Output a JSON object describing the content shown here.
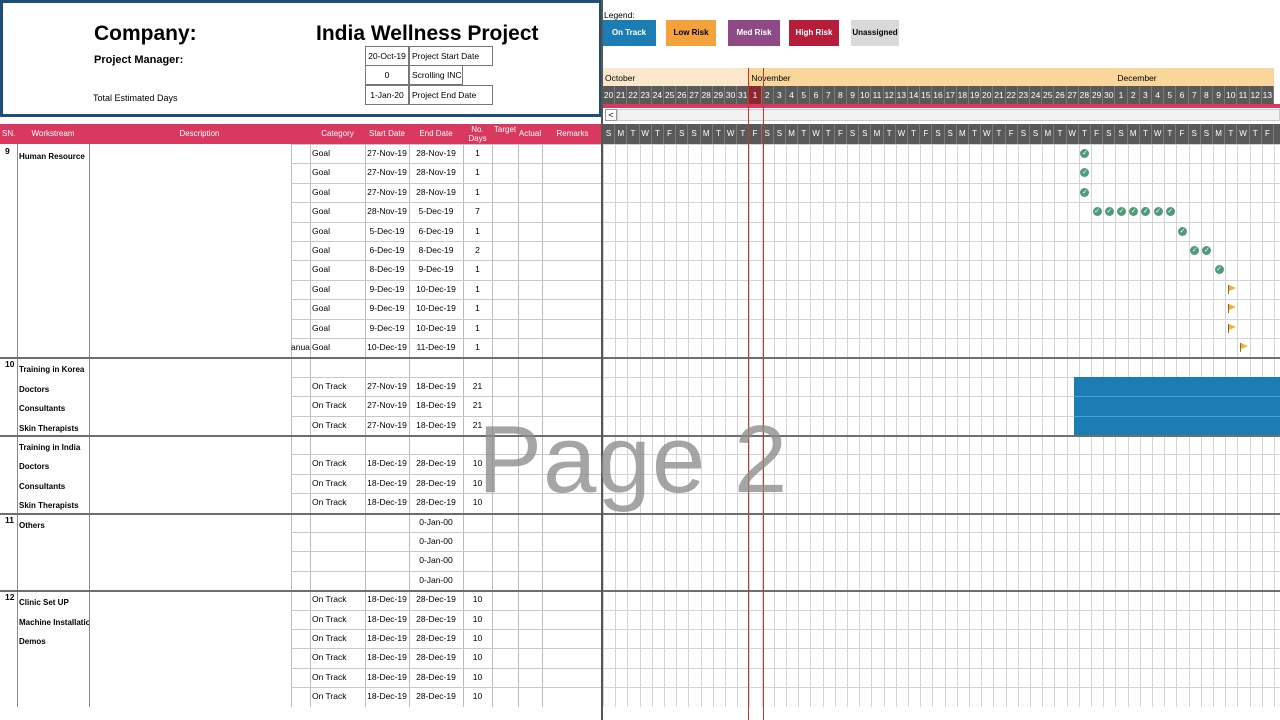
{
  "header": {
    "company_label": "Company:",
    "project_title": "India Wellness Project",
    "manager_label": "Project Manager:",
    "total_days_label": "Total Estimated Days",
    "info": [
      {
        "value": "20-Oct-19",
        "label": "Project Start Date"
      },
      {
        "value": "0",
        "label": "Scrolling INC"
      },
      {
        "value": "1-Jan-20",
        "label": "Project End Date"
      }
    ]
  },
  "legend": {
    "title": "Legend:",
    "items": [
      {
        "label": "On Track",
        "bg": "#1b7db3",
        "fg": "#ffffff"
      },
      {
        "label": "Low Risk",
        "bg": "#f4a23c",
        "fg": "#000000"
      },
      {
        "label": "Med Risk",
        "bg": "#8f4a86",
        "fg": "#ffffff"
      },
      {
        "label": "High Risk",
        "bg": "#b51d3b",
        "fg": "#ffffff"
      },
      {
        "label": "Unassigned",
        "bg": "#d9d9d9",
        "fg": "#000000"
      }
    ]
  },
  "timeline": {
    "months": [
      {
        "label": "October",
        "bg": "#fbe7cc"
      },
      {
        "label": "November",
        "bg": "#f9d79b"
      },
      {
        "label": "December",
        "bg": "#f9d79b"
      }
    ],
    "dates": [
      "20",
      "21",
      "22",
      "23",
      "24",
      "25",
      "26",
      "27",
      "28",
      "29",
      "30",
      "31",
      "1",
      "2",
      "3",
      "4",
      "5",
      "6",
      "7",
      "8",
      "9",
      "10",
      "11",
      "12",
      "13",
      "14",
      "15",
      "16",
      "17",
      "18",
      "19",
      "20",
      "21",
      "22",
      "23",
      "24",
      "25",
      "26",
      "27",
      "28",
      "29",
      "30",
      "1",
      "2",
      "3",
      "4",
      "5",
      "6",
      "7",
      "8",
      "9",
      "10",
      "11",
      "12",
      "13"
    ],
    "days": [
      "S",
      "M",
      "T",
      "W",
      "T",
      "F",
      "S",
      "S",
      "M",
      "T",
      "W",
      "T",
      "F",
      "S",
      "S",
      "M",
      "T",
      "W",
      "T",
      "F",
      "S",
      "S",
      "M",
      "T",
      "W",
      "T",
      "F",
      "S",
      "S",
      "M",
      "T",
      "W",
      "T",
      "F",
      "S",
      "S",
      "M",
      "T",
      "W",
      "T",
      "F",
      "S",
      "S",
      "M",
      "T",
      "W",
      "T",
      "F",
      "S",
      "S",
      "M",
      "T",
      "W",
      "T",
      "F"
    ],
    "scroll_left": "<"
  },
  "columns": {
    "sn": "SN.",
    "workstream": "Workstream",
    "description": "Description",
    "category": "Category",
    "start": "Start Date",
    "end": "End Date",
    "days": "No. Days",
    "target": "Target",
    "actual": "Actual",
    "remarks": "Remarks"
  },
  "rows": [
    {
      "sn": "9",
      "ws": "Human Resource",
      "cat_pre": "",
      "cat": "Goal",
      "start": "27-Nov-19",
      "end": "28-Nov-19",
      "days": "1"
    },
    {
      "sn": "",
      "ws": "",
      "cat_pre": "",
      "cat": "Goal",
      "start": "27-Nov-19",
      "end": "28-Nov-19",
      "days": "1"
    },
    {
      "sn": "",
      "ws": "",
      "cat_pre": "",
      "cat": "Goal",
      "start": "27-Nov-19",
      "end": "28-Nov-19",
      "days": "1"
    },
    {
      "sn": "",
      "ws": "",
      "cat_pre": "",
      "cat": "Goal",
      "start": "28-Nov-19",
      "end": "5-Dec-19",
      "days": "7"
    },
    {
      "sn": "",
      "ws": "",
      "cat_pre": "",
      "cat": "Goal",
      "start": "5-Dec-19",
      "end": "6-Dec-19",
      "days": "1"
    },
    {
      "sn": "",
      "ws": "",
      "cat_pre": "",
      "cat": "Goal",
      "start": "6-Dec-19",
      "end": "8-Dec-19",
      "days": "2"
    },
    {
      "sn": "",
      "ws": "",
      "cat_pre": "",
      "cat": "Goal",
      "start": "8-Dec-19",
      "end": "9-Dec-19",
      "days": "1"
    },
    {
      "sn": "",
      "ws": "",
      "cat_pre": "",
      "cat": "Goal",
      "start": "9-Dec-19",
      "end": "10-Dec-19",
      "days": "1"
    },
    {
      "sn": "",
      "ws": "",
      "cat_pre": "",
      "cat": "Goal",
      "start": "9-Dec-19",
      "end": "10-Dec-19",
      "days": "1"
    },
    {
      "sn": "",
      "ws": "",
      "cat_pre": "",
      "cat": "Goal",
      "start": "9-Dec-19",
      "end": "10-Dec-19",
      "days": "1"
    },
    {
      "sn": "",
      "ws": "",
      "cat_pre": "anua",
      "cat": "Goal",
      "start": "10-Dec-19",
      "end": "11-Dec-19",
      "days": "1"
    },
    {
      "sn": "10",
      "ws": "Training in Korea",
      "cat_pre": "",
      "cat": "",
      "start": "",
      "end": "",
      "days": ""
    },
    {
      "sn": "",
      "ws": "Doctors",
      "cat_pre": "",
      "cat": "On Track",
      "start": "27-Nov-19",
      "end": "18-Dec-19",
      "days": "21"
    },
    {
      "sn": "",
      "ws": "Consultants",
      "cat_pre": "",
      "cat": "On Track",
      "start": "27-Nov-19",
      "end": "18-Dec-19",
      "days": "21"
    },
    {
      "sn": "",
      "ws": "Skin Therapists",
      "cat_pre": "",
      "cat": "On Track",
      "start": "27-Nov-19",
      "end": "18-Dec-19",
      "days": "21"
    },
    {
      "sn": "",
      "ws": "Training in India",
      "cat_pre": "",
      "cat": "",
      "start": "",
      "end": "",
      "days": ""
    },
    {
      "sn": "",
      "ws": "Doctors",
      "cat_pre": "",
      "cat": "On Track",
      "start": "18-Dec-19",
      "end": "28-Dec-19",
      "days": "10"
    },
    {
      "sn": "",
      "ws": "Consultants",
      "cat_pre": "",
      "cat": "On Track",
      "start": "18-Dec-19",
      "end": "28-Dec-19",
      "days": "10"
    },
    {
      "sn": "",
      "ws": "Skin Therapists",
      "cat_pre": "",
      "cat": "On Track",
      "start": "18-Dec-19",
      "end": "28-Dec-19",
      "days": "10"
    },
    {
      "sn": "11",
      "ws": "Others",
      "cat_pre": "",
      "cat": "",
      "start": "",
      "end": "0-Jan-00",
      "days": ""
    },
    {
      "sn": "",
      "ws": "",
      "cat_pre": "",
      "cat": "",
      "start": "",
      "end": "0-Jan-00",
      "days": ""
    },
    {
      "sn": "",
      "ws": "",
      "cat_pre": "",
      "cat": "",
      "start": "",
      "end": "0-Jan-00",
      "days": ""
    },
    {
      "sn": "",
      "ws": "",
      "cat_pre": "",
      "cat": "",
      "start": "",
      "end": "0-Jan-00",
      "days": ""
    },
    {
      "sn": "12",
      "ws": "Clinic Set UP",
      "cat_pre": "",
      "cat": "On Track",
      "start": "18-Dec-19",
      "end": "28-Dec-19",
      "days": "10"
    },
    {
      "sn": "",
      "ws": "Machine Installation",
      "cat_pre": "",
      "cat": "On Track",
      "start": "18-Dec-19",
      "end": "28-Dec-19",
      "days": "10"
    },
    {
      "sn": "",
      "ws": "Demos",
      "cat_pre": "",
      "cat": "On Track",
      "start": "18-Dec-19",
      "end": "28-Dec-19",
      "days": "10"
    },
    {
      "sn": "",
      "ws": "",
      "cat_pre": "",
      "cat": "On Track",
      "start": "18-Dec-19",
      "end": "28-Dec-19",
      "days": "10"
    },
    {
      "sn": "",
      "ws": "",
      "cat_pre": "",
      "cat": "On Track",
      "start": "18-Dec-19",
      "end": "28-Dec-19",
      "days": "10"
    },
    {
      "sn": "",
      "ws": "",
      "cat_pre": "",
      "cat": "On Track",
      "start": "18-Dec-19",
      "end": "28-Dec-19",
      "days": "10"
    }
  ],
  "watermark": "Page 2",
  "colors": {
    "header_band": "#d9385f",
    "header_box_border": "#1f4e79",
    "milestone": "#4f9a7b",
    "flag": "#f0b13a",
    "on_track_bar": "#1b7db3",
    "today_line": "#c0392b"
  }
}
